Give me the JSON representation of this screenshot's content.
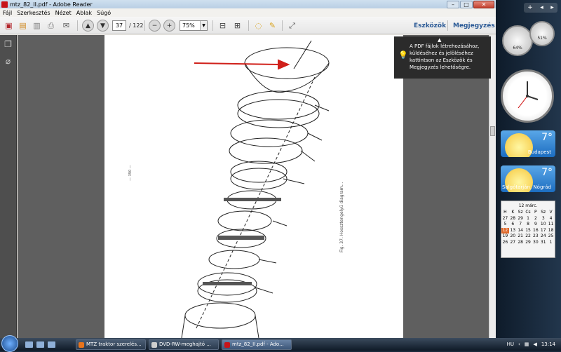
{
  "window": {
    "title": "mtz_82_II.pdf - Adobe Reader"
  },
  "menu": [
    "Fájl",
    "Szerkesztés",
    "Nézet",
    "Ablak",
    "Súgó"
  ],
  "toolbar": {
    "page_current": "37",
    "page_total": "/ 122",
    "zoom": "75%",
    "tools_label": "Eszközök",
    "comment_label": "Megjegyzés"
  },
  "tooltip": {
    "text": "A PDF fájlok létrehozásához, küldéséhez és jelöléséhez kattintson az Eszközök és Megjegyzés lehetőségre."
  },
  "document": {
    "side_caption": "Fig. 37. Hossztengelyű diagram...",
    "left_mark": "— 390 —"
  },
  "sidebar": {
    "cpu_label": "64%",
    "mem_label": "51%",
    "weather": [
      {
        "temp": "7°",
        "city": "Budapest"
      },
      {
        "temp": "7°",
        "city": "Salgótarján, Nógrád"
      }
    ],
    "calendar": {
      "month": "12 márc.",
      "weekdays": [
        "H",
        "K",
        "Sz",
        "Cs",
        "P",
        "Sz",
        "V"
      ],
      "weeks": [
        [
          "27",
          "28",
          "29",
          "1",
          "2",
          "3",
          "4"
        ],
        [
          "5",
          "6",
          "7",
          "8",
          "9",
          "10",
          "11"
        ],
        [
          "12",
          "13",
          "14",
          "15",
          "16",
          "17",
          "18"
        ],
        [
          "19",
          "20",
          "21",
          "22",
          "23",
          "24",
          "25"
        ],
        [
          "26",
          "27",
          "28",
          "29",
          "30",
          "31",
          "1"
        ]
      ]
    }
  },
  "taskbar": {
    "tasks": [
      {
        "label": "MTZ traktor szerelés...",
        "icon_color": "#e8741c"
      },
      {
        "label": "DVD-RW-meghajtó ...",
        "icon_color": "#cfcfcf"
      },
      {
        "label": "mtz_82_II.pdf - Ado...",
        "icon_color": "#c8141a"
      }
    ],
    "lang": "HU",
    "time": "13:14"
  }
}
